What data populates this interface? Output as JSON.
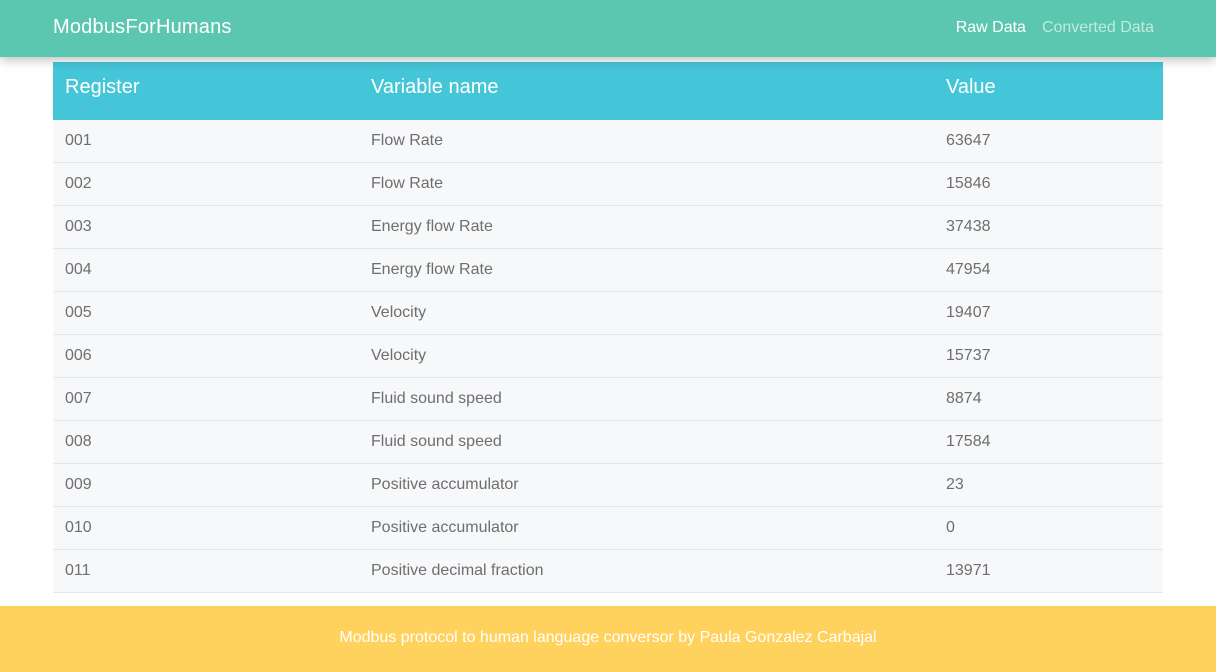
{
  "navbar": {
    "brand": "ModbusForHumans",
    "links": [
      {
        "label": "Raw Data"
      },
      {
        "label": "Converted Data"
      }
    ]
  },
  "table": {
    "headers": {
      "register": "Register",
      "variable": "Variable name",
      "value": "Value"
    },
    "rows": [
      {
        "register": "001",
        "variable": "Flow Rate",
        "value": "63647"
      },
      {
        "register": "002",
        "variable": "Flow Rate",
        "value": "15846"
      },
      {
        "register": "003",
        "variable": "Energy flow Rate",
        "value": "37438"
      },
      {
        "register": "004",
        "variable": "Energy flow Rate",
        "value": "47954"
      },
      {
        "register": "005",
        "variable": "Velocity",
        "value": "19407"
      },
      {
        "register": "006",
        "variable": "Velocity",
        "value": "15737"
      },
      {
        "register": "007",
        "variable": "Fluid sound speed",
        "value": "8874"
      },
      {
        "register": "008",
        "variable": "Fluid sound speed",
        "value": "17584"
      },
      {
        "register": "009",
        "variable": "Positive accumulator",
        "value": "23"
      },
      {
        "register": "010",
        "variable": "Positive accumulator",
        "value": "0"
      },
      {
        "register": "011",
        "variable": "Positive decimal fraction",
        "value": "13971"
      }
    ]
  },
  "footer": {
    "text": "Modbus protocol to human language conversor by Paula Gonzalez Carbajal"
  }
}
